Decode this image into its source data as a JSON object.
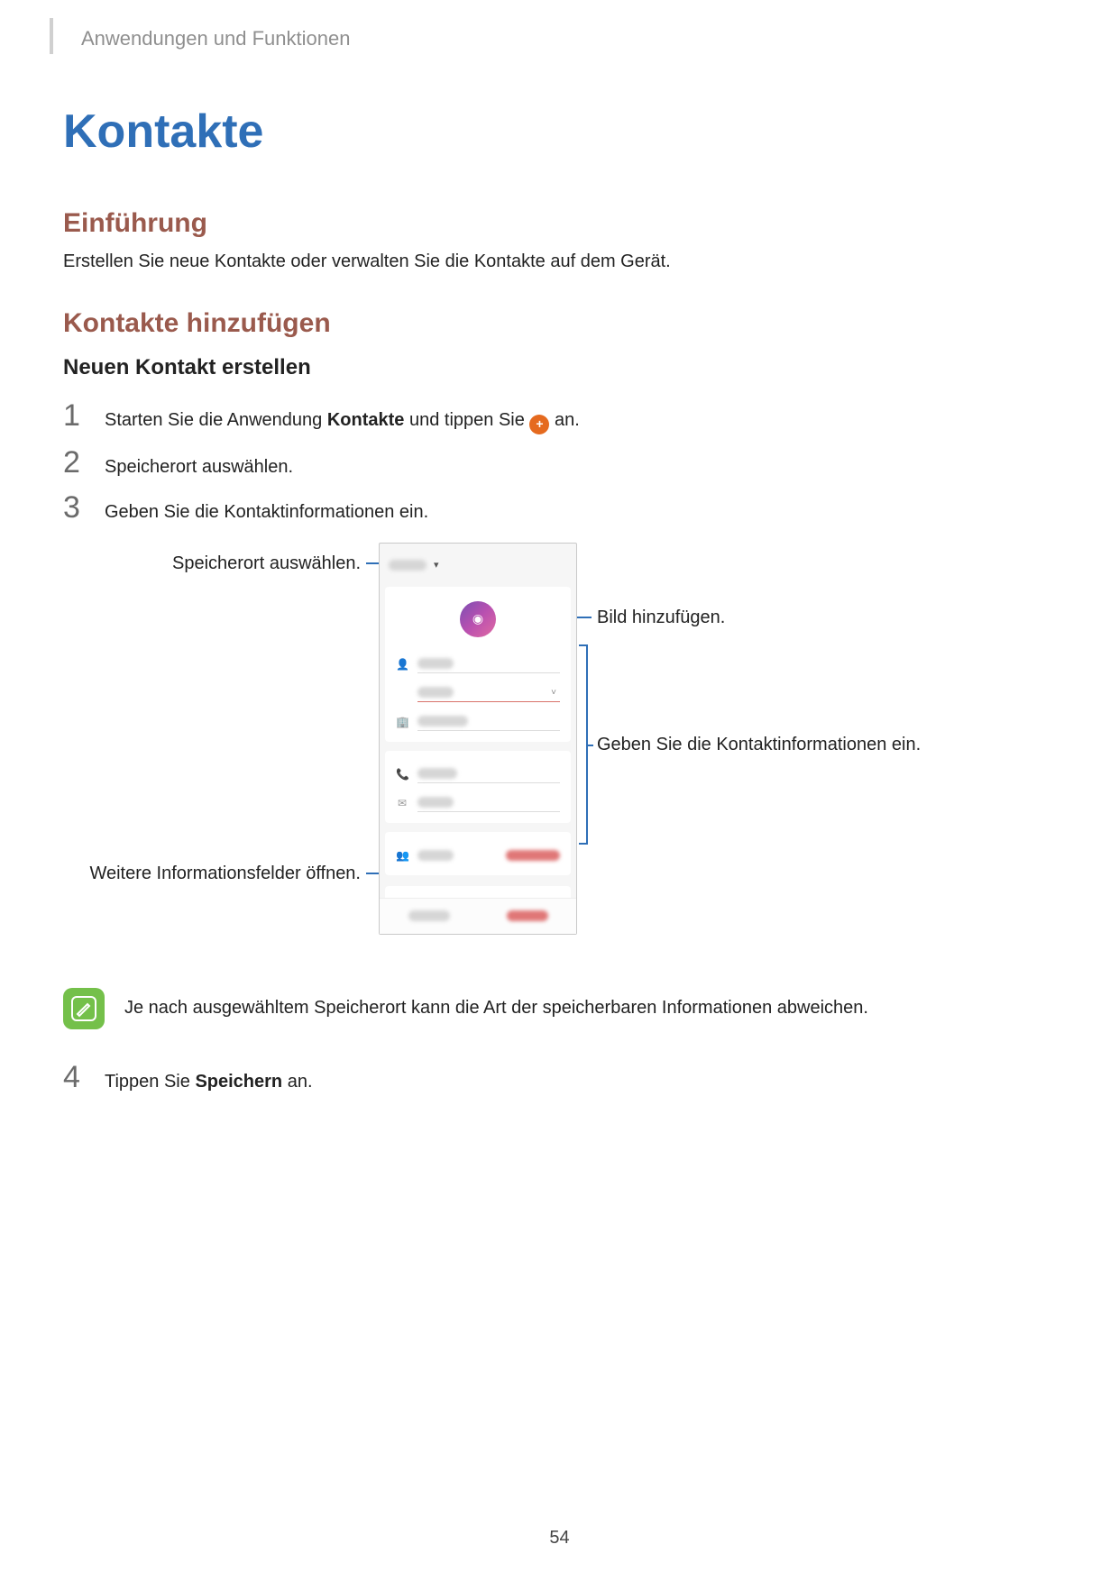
{
  "breadcrumb": "Anwendungen und Funktionen",
  "title": "Kontakte",
  "intro": {
    "heading": "Einführung",
    "text": "Erstellen Sie neue Kontakte oder verwalten Sie die Kontakte auf dem Gerät."
  },
  "section": {
    "heading": "Kontakte hinzufügen",
    "subheading": "Neuen Kontakt erstellen"
  },
  "steps": [
    {
      "num": "1",
      "pre": "Starten Sie die Anwendung ",
      "bold1": "Kontakte",
      "mid": " und tippen Sie ",
      "post": " an."
    },
    {
      "num": "2",
      "text": "Speicherort auswählen."
    },
    {
      "num": "3",
      "text": "Geben Sie die Kontaktinformationen ein."
    },
    {
      "num": "4",
      "pre": "Tippen Sie ",
      "bold1": "Speichern",
      "post": " an."
    }
  ],
  "callouts": {
    "storage": "Speicherort auswählen.",
    "photo": "Bild hinzufügen.",
    "info": "Geben Sie die Kontaktinformationen ein.",
    "more": "Weitere Informationsfelder öffnen."
  },
  "note": "Je nach ausgewähltem Speicherort kann die Art der speicherbaren Informationen abweichen.",
  "page_number": "54",
  "icons": {
    "add_plus": "+",
    "camera": "◉",
    "dropdown_caret": "▾",
    "chevron_down": "˅",
    "person": "👤",
    "building": "🏢",
    "phone": "📞",
    "mail": "✉",
    "group": "👥"
  }
}
